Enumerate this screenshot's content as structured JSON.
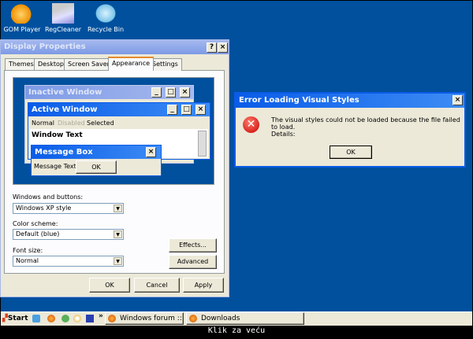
{
  "desktop": {
    "icons": [
      {
        "label": "GOM Player",
        "icon": "gom-player-icon"
      },
      {
        "label": "RegCleaner",
        "icon": "regcleaner-icon"
      },
      {
        "label": "Recycle Bin",
        "icon": "recycle-bin-icon"
      }
    ]
  },
  "display_properties": {
    "title": "Display Properties",
    "help": "?",
    "close": "×",
    "tabs": [
      "Themes",
      "Desktop",
      "Screen Saver",
      "Appearance",
      "Settings"
    ],
    "active_tab": "Appearance",
    "preview": {
      "inactive_title": "Inactive Window",
      "active_title": "Active Window",
      "menu": [
        "Normal",
        "Disabled",
        "Selected"
      ],
      "window_text": "Window Text",
      "msgbox_title": "Message Box",
      "msgbox_text": "Message Text",
      "msgbox_ok": "OK"
    },
    "windows_buttons_label": "Windows and buttons:",
    "windows_buttons_value": "Windows XP style",
    "color_scheme_label": "Color scheme:",
    "color_scheme_value": "Default (blue)",
    "font_size_label": "Font size:",
    "font_size_value": "Normal",
    "effects": "Effects...",
    "advanced": "Advanced",
    "ok": "OK",
    "cancel": "Cancel",
    "apply": "Apply"
  },
  "error_dialog": {
    "title": "Error Loading Visual Styles",
    "message": "The visual styles could not be loaded because the file failed to load.",
    "details": "Details:",
    "ok": "OK",
    "close": "×"
  },
  "taskbar": {
    "start": "Start",
    "chevron": "»",
    "quick_launch": [
      "ie-icon",
      "firefox-icon",
      "messenger-icon",
      "media-player-icon",
      "save-icon"
    ],
    "tasks": [
      "Windows forum :: ...",
      "Downloads"
    ]
  },
  "caption": "Klik za veću",
  "colors": {
    "desktop": "#00509e",
    "titlebar_active": "#0a5ce8",
    "titlebar_inactive": "#7d9ae6",
    "window_face": "#ece9d8"
  }
}
